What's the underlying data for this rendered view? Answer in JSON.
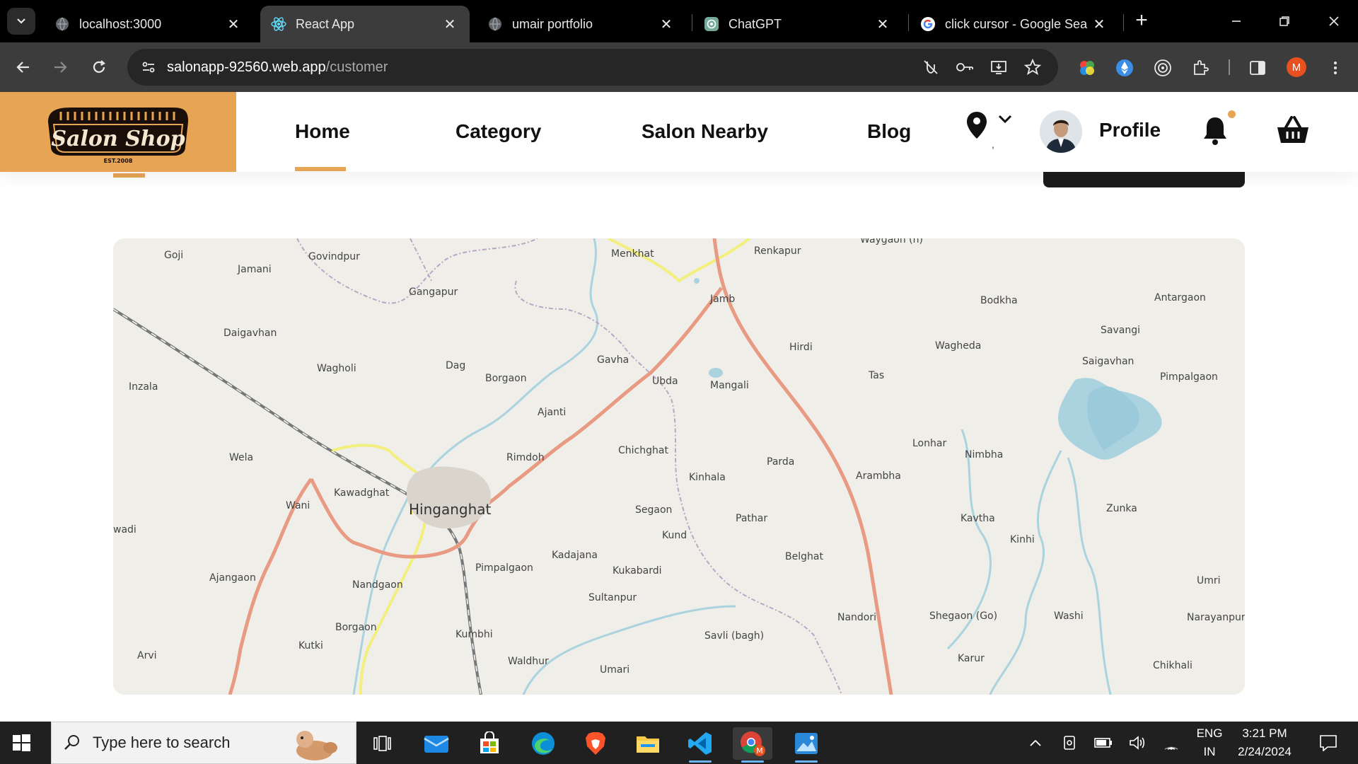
{
  "browser": {
    "tabs": [
      {
        "title": "localhost:3000",
        "favicon": "globe-icon",
        "active": false
      },
      {
        "title": "React App",
        "favicon": "react-icon",
        "active": true
      },
      {
        "title": "umair portfolio",
        "favicon": "globe-icon",
        "active": false
      },
      {
        "title": "ChatGPT",
        "favicon": "chatgpt-icon",
        "active": false
      },
      {
        "title": "click cursor - Google Sea",
        "favicon": "google-icon",
        "active": false
      }
    ],
    "url_host": "salonapp-92560.web.app",
    "url_path": "/customer",
    "profile_initial": "M"
  },
  "app": {
    "logo": {
      "text": "Salon Shop",
      "est": "EST.2008"
    },
    "nav": {
      "home": "Home",
      "category": "Category",
      "salon_nearby": "Salon Nearby",
      "blog": "Blog",
      "location_value": ",",
      "profile": "Profile"
    },
    "accent_color": "#e8a455"
  },
  "map": {
    "places": [
      {
        "name": "Goji"
      },
      {
        "name": "Govindpur"
      },
      {
        "name": "Jamani"
      },
      {
        "name": "Menkhat"
      },
      {
        "name": "Renkapur"
      },
      {
        "name": "Waygaon (n)"
      },
      {
        "name": "Gangapur"
      },
      {
        "name": "Jamb"
      },
      {
        "name": "Bodkha"
      },
      {
        "name": "Antargaon"
      },
      {
        "name": "Daigavhan"
      },
      {
        "name": "Savangi"
      },
      {
        "name": "Hirdi"
      },
      {
        "name": "Wagheda"
      },
      {
        "name": "Gavha"
      },
      {
        "name": "Saigavhan"
      },
      {
        "name": "Wagholi"
      },
      {
        "name": "Dag"
      },
      {
        "name": "Borgaon"
      },
      {
        "name": "Tas"
      },
      {
        "name": "Ubda"
      },
      {
        "name": "Mangali"
      },
      {
        "name": "Inzala"
      },
      {
        "name": "Pimpalgaon"
      },
      {
        "name": "Ajanti"
      },
      {
        "name": "Lonhar"
      },
      {
        "name": "Chichghat"
      },
      {
        "name": "Rimdoh"
      },
      {
        "name": "Nimbha"
      },
      {
        "name": "Wela"
      },
      {
        "name": "Parda"
      },
      {
        "name": "Kinhala"
      },
      {
        "name": "Arambha"
      },
      {
        "name": "Kawadghat"
      },
      {
        "name": "Wani"
      },
      {
        "name": "Hinganghat"
      },
      {
        "name": "Segaon"
      },
      {
        "name": "Zunka"
      },
      {
        "name": "Pathar"
      },
      {
        "name": "Kavtha"
      },
      {
        "name": "wadi"
      },
      {
        "name": "Kund"
      },
      {
        "name": "Kinhi"
      },
      {
        "name": "Kadajana"
      },
      {
        "name": "Belghat"
      },
      {
        "name": "Pimpalgaon"
      },
      {
        "name": "Kukabardi"
      },
      {
        "name": "Ajangaon"
      },
      {
        "name": "Umri"
      },
      {
        "name": "Nandgaon"
      },
      {
        "name": "Sultanpur"
      },
      {
        "name": "Nandori"
      },
      {
        "name": "Shegaon (Go)"
      },
      {
        "name": "Washi"
      },
      {
        "name": "Narayanpur"
      },
      {
        "name": "Borgaon"
      },
      {
        "name": "Kumbhi"
      },
      {
        "name": "Savli (bagh)"
      },
      {
        "name": "Kutki"
      },
      {
        "name": "Arvi"
      },
      {
        "name": "Waldhur"
      },
      {
        "name": "Karur"
      },
      {
        "name": "Umari"
      },
      {
        "name": "Chikhali"
      }
    ]
  },
  "taskbar": {
    "search_placeholder": "Type here to search",
    "lang_line1": "ENG",
    "lang_line2": "IN",
    "time": "3:21 PM",
    "date": "2/24/2024"
  }
}
